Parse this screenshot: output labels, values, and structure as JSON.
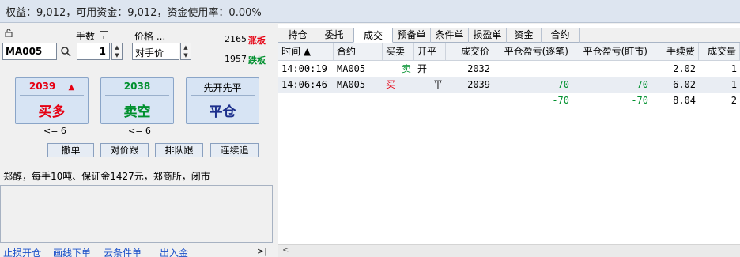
{
  "topbar": {
    "text": "权益：9,012，可用资金：9,012，资金使用率：0.00%"
  },
  "order": {
    "code": "MA005",
    "qty_label": "手数",
    "qty_value": "1",
    "price_label": "价格 ...",
    "price_value": "对手价",
    "limit_up_price": "2165",
    "limit_up_label": "涨板",
    "limit_down_price": "1957",
    "limit_down_label": "跌板",
    "buy": {
      "price": "2039",
      "arrow": "▲",
      "label": "买多",
      "avail": "<= 6"
    },
    "sell": {
      "price": "2038",
      "label": "卖空",
      "avail": "<= 6"
    },
    "close": {
      "top": "先开先平",
      "label": "平仓"
    },
    "buttons": [
      "撤单",
      "对价跟",
      "排队跟",
      "连续追"
    ],
    "info": "郑醇，每手10吨、保证金1427元，郑商所，闭市"
  },
  "bottom_links": [
    "止损开仓",
    "画线下单",
    "云条件单",
    "出入金"
  ],
  "collapse": ">|",
  "tabs": [
    "持仓",
    "委托",
    "成交",
    "预备单",
    "条件单",
    "损盈单",
    "资金",
    "合约"
  ],
  "active_tab": "成交",
  "table": {
    "headers": [
      "时间 ▲",
      "合约",
      "买卖",
      "开平",
      "成交价",
      "平仓盈亏(逐笔)",
      "平仓盈亏(盯市)",
      "手续费",
      "成交量"
    ],
    "rows": [
      [
        "14:00:19",
        "MA005",
        "卖",
        "开",
        "2032",
        "",
        "",
        "2.02",
        "1"
      ],
      [
        "14:06:46",
        "MA005",
        "买",
        "平",
        "2039",
        "-70",
        "-70",
        "6.02",
        "1"
      ],
      [
        "",
        "",
        "",
        "",
        "",
        "-70",
        "-70",
        "8.04",
        "2"
      ]
    ]
  },
  "colors": {
    "buy": "#e60012",
    "sell": "#00902e",
    "close": "#1c2f8c",
    "link": "#1a4fc8",
    "pnl": "#00902e"
  }
}
